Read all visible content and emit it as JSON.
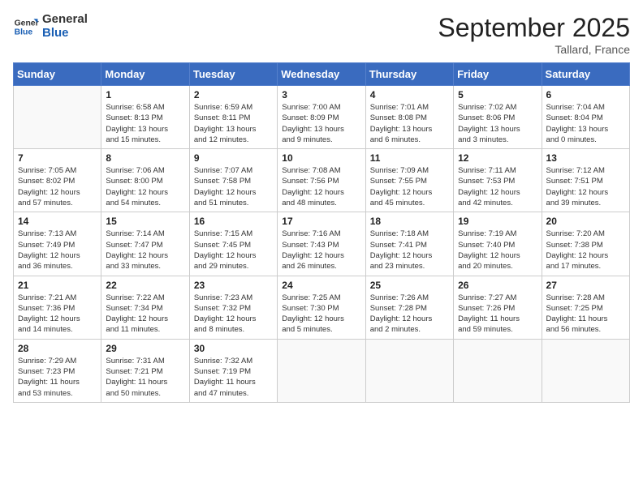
{
  "logo": {
    "text_general": "General",
    "text_blue": "Blue"
  },
  "header": {
    "month_year": "September 2025",
    "location": "Tallard, France"
  },
  "weekdays": [
    "Sunday",
    "Monday",
    "Tuesday",
    "Wednesday",
    "Thursday",
    "Friday",
    "Saturday"
  ],
  "weeks": [
    [
      {
        "day": "",
        "info": ""
      },
      {
        "day": "1",
        "info": "Sunrise: 6:58 AM\nSunset: 8:13 PM\nDaylight: 13 hours\nand 15 minutes."
      },
      {
        "day": "2",
        "info": "Sunrise: 6:59 AM\nSunset: 8:11 PM\nDaylight: 13 hours\nand 12 minutes."
      },
      {
        "day": "3",
        "info": "Sunrise: 7:00 AM\nSunset: 8:09 PM\nDaylight: 13 hours\nand 9 minutes."
      },
      {
        "day": "4",
        "info": "Sunrise: 7:01 AM\nSunset: 8:08 PM\nDaylight: 13 hours\nand 6 minutes."
      },
      {
        "day": "5",
        "info": "Sunrise: 7:02 AM\nSunset: 8:06 PM\nDaylight: 13 hours\nand 3 minutes."
      },
      {
        "day": "6",
        "info": "Sunrise: 7:04 AM\nSunset: 8:04 PM\nDaylight: 13 hours\nand 0 minutes."
      }
    ],
    [
      {
        "day": "7",
        "info": "Sunrise: 7:05 AM\nSunset: 8:02 PM\nDaylight: 12 hours\nand 57 minutes."
      },
      {
        "day": "8",
        "info": "Sunrise: 7:06 AM\nSunset: 8:00 PM\nDaylight: 12 hours\nand 54 minutes."
      },
      {
        "day": "9",
        "info": "Sunrise: 7:07 AM\nSunset: 7:58 PM\nDaylight: 12 hours\nand 51 minutes."
      },
      {
        "day": "10",
        "info": "Sunrise: 7:08 AM\nSunset: 7:56 PM\nDaylight: 12 hours\nand 48 minutes."
      },
      {
        "day": "11",
        "info": "Sunrise: 7:09 AM\nSunset: 7:55 PM\nDaylight: 12 hours\nand 45 minutes."
      },
      {
        "day": "12",
        "info": "Sunrise: 7:11 AM\nSunset: 7:53 PM\nDaylight: 12 hours\nand 42 minutes."
      },
      {
        "day": "13",
        "info": "Sunrise: 7:12 AM\nSunset: 7:51 PM\nDaylight: 12 hours\nand 39 minutes."
      }
    ],
    [
      {
        "day": "14",
        "info": "Sunrise: 7:13 AM\nSunset: 7:49 PM\nDaylight: 12 hours\nand 36 minutes."
      },
      {
        "day": "15",
        "info": "Sunrise: 7:14 AM\nSunset: 7:47 PM\nDaylight: 12 hours\nand 33 minutes."
      },
      {
        "day": "16",
        "info": "Sunrise: 7:15 AM\nSunset: 7:45 PM\nDaylight: 12 hours\nand 29 minutes."
      },
      {
        "day": "17",
        "info": "Sunrise: 7:16 AM\nSunset: 7:43 PM\nDaylight: 12 hours\nand 26 minutes."
      },
      {
        "day": "18",
        "info": "Sunrise: 7:18 AM\nSunset: 7:41 PM\nDaylight: 12 hours\nand 23 minutes."
      },
      {
        "day": "19",
        "info": "Sunrise: 7:19 AM\nSunset: 7:40 PM\nDaylight: 12 hours\nand 20 minutes."
      },
      {
        "day": "20",
        "info": "Sunrise: 7:20 AM\nSunset: 7:38 PM\nDaylight: 12 hours\nand 17 minutes."
      }
    ],
    [
      {
        "day": "21",
        "info": "Sunrise: 7:21 AM\nSunset: 7:36 PM\nDaylight: 12 hours\nand 14 minutes."
      },
      {
        "day": "22",
        "info": "Sunrise: 7:22 AM\nSunset: 7:34 PM\nDaylight: 12 hours\nand 11 minutes."
      },
      {
        "day": "23",
        "info": "Sunrise: 7:23 AM\nSunset: 7:32 PM\nDaylight: 12 hours\nand 8 minutes."
      },
      {
        "day": "24",
        "info": "Sunrise: 7:25 AM\nSunset: 7:30 PM\nDaylight: 12 hours\nand 5 minutes."
      },
      {
        "day": "25",
        "info": "Sunrise: 7:26 AM\nSunset: 7:28 PM\nDaylight: 12 hours\nand 2 minutes."
      },
      {
        "day": "26",
        "info": "Sunrise: 7:27 AM\nSunset: 7:26 PM\nDaylight: 11 hours\nand 59 minutes."
      },
      {
        "day": "27",
        "info": "Sunrise: 7:28 AM\nSunset: 7:25 PM\nDaylight: 11 hours\nand 56 minutes."
      }
    ],
    [
      {
        "day": "28",
        "info": "Sunrise: 7:29 AM\nSunset: 7:23 PM\nDaylight: 11 hours\nand 53 minutes."
      },
      {
        "day": "29",
        "info": "Sunrise: 7:31 AM\nSunset: 7:21 PM\nDaylight: 11 hours\nand 50 minutes."
      },
      {
        "day": "30",
        "info": "Sunrise: 7:32 AM\nSunset: 7:19 PM\nDaylight: 11 hours\nand 47 minutes."
      },
      {
        "day": "",
        "info": ""
      },
      {
        "day": "",
        "info": ""
      },
      {
        "day": "",
        "info": ""
      },
      {
        "day": "",
        "info": ""
      }
    ]
  ]
}
